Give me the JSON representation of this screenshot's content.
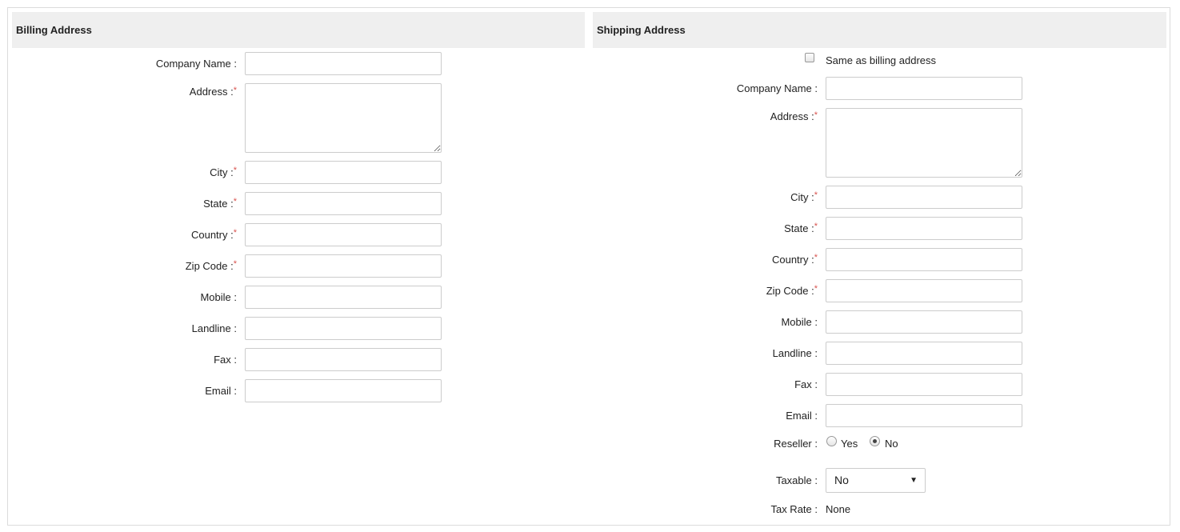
{
  "billing": {
    "title": "Billing Address",
    "labels": {
      "company_name": "Company Name :",
      "address": "Address :",
      "city": "City :",
      "state": "State :",
      "country": "Country :",
      "zip_code": "Zip Code :",
      "mobile": "Mobile :",
      "landline": "Landline :",
      "fax": "Fax :",
      "email": "Email :"
    },
    "values": {
      "company_name": "",
      "address": "",
      "city": "",
      "state": "",
      "country": "",
      "zip_code": "",
      "mobile": "",
      "landline": "",
      "fax": "",
      "email": ""
    }
  },
  "shipping": {
    "title": "Shipping Address",
    "same_as_billing_label": "Same as billing address",
    "same_as_billing_checked": false,
    "labels": {
      "company_name": "Company Name :",
      "address": "Address :",
      "city": "City :",
      "state": "State :",
      "country": "Country :",
      "zip_code": "Zip Code :",
      "mobile": "Mobile :",
      "landline": "Landline :",
      "fax": "Fax :",
      "email": "Email :",
      "reseller": "Reseller :",
      "taxable": "Taxable :",
      "tax_rate": "Tax Rate :"
    },
    "values": {
      "company_name": "",
      "address": "",
      "city": "",
      "state": "",
      "country": "",
      "zip_code": "",
      "mobile": "",
      "landline": "",
      "fax": "",
      "email": ""
    },
    "reseller_options": {
      "yes": "Yes",
      "no": "No",
      "selected": "No"
    },
    "taxable_value": "No",
    "tax_rate_value": "None"
  },
  "required_marker": "*",
  "caret_glyph": "▼",
  "colors": {
    "header_bg": "#efefef",
    "required": "#d9534f",
    "border": "#cccccc"
  }
}
